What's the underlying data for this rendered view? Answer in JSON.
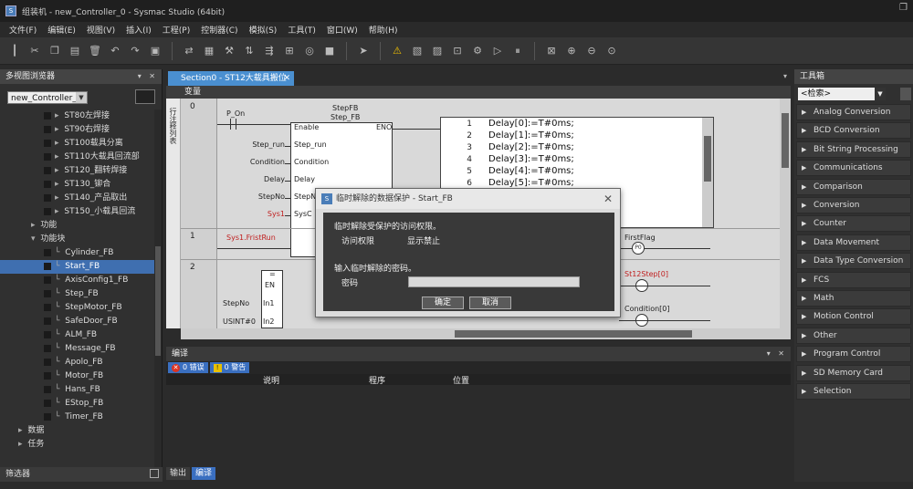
{
  "window": {
    "title": "组装机 - new_Controller_0 - Sysmac Studio (64bit)",
    "app_icon": "S",
    "restore_glyph": "❐"
  },
  "menu": [
    "文件(F)",
    "编辑(E)",
    "视图(V)",
    "插入(I)",
    "工程(P)",
    "控制器(C)",
    "模拟(S)",
    "工具(T)",
    "窗口(W)",
    "帮助(H)"
  ],
  "left_panel": {
    "title": "多视图浏览器",
    "controller_select": "new_Controller_0",
    "filter_label": "筛选器",
    "tree": [
      {
        "label": "ST80左焊接",
        "indent": 3,
        "kind": "prog"
      },
      {
        "label": "ST90右焊接",
        "indent": 3,
        "kind": "prog"
      },
      {
        "label": "ST100载具分离",
        "indent": 3,
        "kind": "prog"
      },
      {
        "label": "ST110大载具回流部",
        "indent": 3,
        "kind": "prog"
      },
      {
        "label": "ST120_翻转焊接",
        "indent": 3,
        "kind": "prog"
      },
      {
        "label": "ST130_铆合",
        "indent": 3,
        "kind": "prog"
      },
      {
        "label": "ST140_产品取出",
        "indent": 3,
        "kind": "prog"
      },
      {
        "label": "ST150_小载具回流",
        "indent": 3,
        "kind": "prog"
      },
      {
        "label": "功能",
        "indent": 2,
        "kind": "folder"
      },
      {
        "label": "功能块",
        "indent": 2,
        "kind": "folder-open"
      },
      {
        "label": "Cylinder_FB",
        "indent": 3,
        "kind": "fb"
      },
      {
        "label": "Start_FB",
        "indent": 3,
        "kind": "fb",
        "selected": true
      },
      {
        "label": "AxisConfig1_FB",
        "indent": 3,
        "kind": "fb"
      },
      {
        "label": "Step_FB",
        "indent": 3,
        "kind": "fb"
      },
      {
        "label": "StepMotor_FB",
        "indent": 3,
        "kind": "fb"
      },
      {
        "label": "SafeDoor_FB",
        "indent": 3,
        "kind": "fb"
      },
      {
        "label": "ALM_FB",
        "indent": 3,
        "kind": "fb"
      },
      {
        "label": "Message_FB",
        "indent": 3,
        "kind": "fb"
      },
      {
        "label": "Apolo_FB",
        "indent": 3,
        "kind": "fb"
      },
      {
        "label": "Motor_FB",
        "indent": 3,
        "kind": "fb"
      },
      {
        "label": "Hans_FB",
        "indent": 3,
        "kind": "fb"
      },
      {
        "label": "EStop_FB",
        "indent": 3,
        "kind": "fb"
      },
      {
        "label": "Timer_FB",
        "indent": 3,
        "kind": "fb"
      },
      {
        "label": "数据",
        "indent": 1,
        "kind": "data"
      },
      {
        "label": "任务",
        "indent": 1,
        "kind": "task"
      }
    ]
  },
  "editor": {
    "tab_label": "Section0 - ST12大载具搬位",
    "variables_label": "变量",
    "vertical_label": "行注释列表",
    "rungs": [
      "0",
      "1",
      "2"
    ],
    "fb_name": "StepFB",
    "fb_type": "Step_FB",
    "contact_p_on": "P_On",
    "pins_in": [
      "Enable",
      "Step_run",
      "Condition",
      "Delay",
      "StepNo",
      "SysC"
    ],
    "pin_enable": "Enable",
    "pin_eno": "ENO",
    "vars_left": [
      "Step_run",
      "Condition",
      "Delay",
      "StepNo",
      "Sys1"
    ],
    "st_lines": [
      {
        "n": "1",
        "code": "Delay[0]:=T#0ms;"
      },
      {
        "n": "2",
        "code": "Delay[1]:=T#0ms;"
      },
      {
        "n": "3",
        "code": "Delay[2]:=T#0ms;"
      },
      {
        "n": "4",
        "code": "Delay[3]:=T#0ms;"
      },
      {
        "n": "5",
        "code": "Delay[4]:=T#0ms;"
      },
      {
        "n": "6",
        "code": "Delay[5]:=T#0ms;"
      }
    ],
    "rung1_contact": "Sys1.FristRun",
    "rung1_coil": "FirstFlag",
    "coil_marker": "P0",
    "rung2_eq_sym": "=",
    "rung2_eq_en": "EN",
    "rung2_in1_var": "StepNo",
    "rung2_in1_pin": "In1",
    "rung2_in2_var": "USINT#0",
    "rung2_in2_pin": "In2",
    "rung2_coil1": "St12Step[0]",
    "rung2_coil2": "Condition[0]"
  },
  "compile_panel": {
    "title": "编译",
    "errors_badge": "0 错误",
    "warnings_badge": "0 警告",
    "columns": [
      "说明",
      "程序",
      "位置"
    ],
    "tabs": [
      "输出",
      "编译"
    ]
  },
  "toolbox": {
    "title": "工具箱",
    "search_placeholder": "<检索>",
    "categories": [
      "Analog Conversion",
      "BCD Conversion",
      "Bit String Processing",
      "Communications",
      "Comparison",
      "Conversion",
      "Counter",
      "Data Movement",
      "Data Type Conversion",
      "FCS",
      "Math",
      "Motion Control",
      "Other",
      "Program Control",
      "SD Memory Card",
      "Selection"
    ]
  },
  "modal": {
    "title": "临时解除的数据保护 - Start_FB",
    "line1": "临时解除受保护的访问权限。",
    "access_label": "访问权限",
    "access_value": "显示禁止",
    "prompt": "输入临时解除的密码。",
    "password_label": "密码",
    "ok_label": "确定",
    "cancel_label": "取消"
  }
}
